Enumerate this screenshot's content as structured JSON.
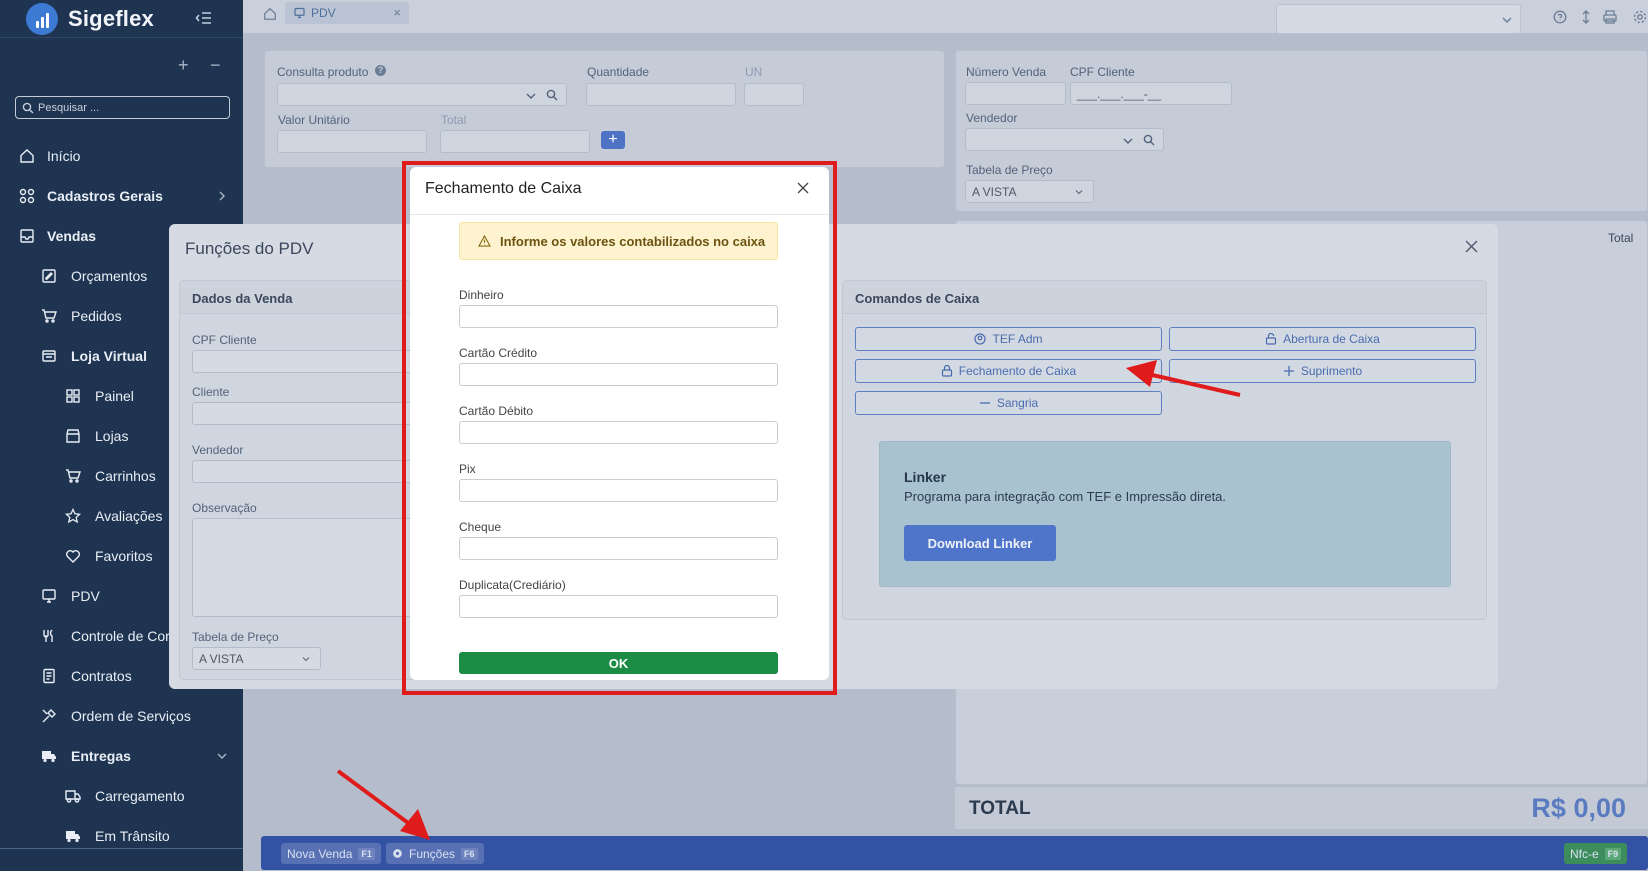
{
  "app": {
    "name": "Sigeflex"
  },
  "sidebar": {
    "search_placeholder": "Pesquisar ...",
    "items": [
      {
        "label": "Início",
        "icon": "home-icon"
      },
      {
        "label": "Cadastros Gerais",
        "icon": "grid-icon"
      },
      {
        "label": "Vendas",
        "icon": "inbox-icon"
      },
      {
        "label": "Orçamentos",
        "icon": "edit-icon"
      },
      {
        "label": "Pedidos",
        "icon": "cart-icon"
      },
      {
        "label": "Loja Virtual",
        "icon": "store-icon"
      },
      {
        "label": "Painel",
        "icon": "dashboard-icon"
      },
      {
        "label": "Lojas",
        "icon": "shop-icon"
      },
      {
        "label": "Carrinhos",
        "icon": "cart-icon"
      },
      {
        "label": "Avaliações",
        "icon": "star-icon"
      },
      {
        "label": "Favoritos",
        "icon": "heart-icon"
      },
      {
        "label": "PDV",
        "icon": "monitor-icon"
      },
      {
        "label": "Controle de Cor",
        "icon": "utensils-icon"
      },
      {
        "label": "Contratos",
        "icon": "document-icon"
      },
      {
        "label": "Ordem de Serviços",
        "icon": "tools-icon"
      },
      {
        "label": "Entregas",
        "icon": "truck-icon"
      },
      {
        "label": "Carregamento",
        "icon": "truck-icon"
      },
      {
        "label": "Em Trânsito",
        "icon": "truck-icon"
      }
    ]
  },
  "tabs": {
    "active": "PDV"
  },
  "form": {
    "consulta_produto": "Consulta produto",
    "quantidade": "Quantidade",
    "un": "UN",
    "valor_unitario": "Valor Unitário",
    "total": "Total",
    "numero_venda": "Número Venda",
    "cpf_cliente": "CPF Cliente",
    "cpf_placeholder": "___.___.___-__",
    "vendedor": "Vendedor",
    "tabela_preco": "Tabela de Preço",
    "tabela_preco_value": "A VISTA",
    "items_total_header": "Total"
  },
  "totals": {
    "label": "TOTAL",
    "value": "R$ 0,00"
  },
  "bottom_bar": {
    "nova_venda": "Nova Venda",
    "nova_venda_key": "F1",
    "funcoes": "Funções",
    "funcoes_key": "F6",
    "nfce": "Nfc-e",
    "nfce_key": "F9"
  },
  "funcoes_modal": {
    "title": "Funções do PDV",
    "dados_venda": {
      "title": "Dados da Venda",
      "cpf_cliente": "CPF Cliente",
      "cliente": "Cliente",
      "vendedor": "Vendedor",
      "observacao": "Observação",
      "tabela_preco": "Tabela de Preço",
      "tabela_preco_value": "A VISTA"
    },
    "comandos": {
      "title": "Comandos de Caixa",
      "tef_adm": "TEF Adm",
      "abertura": "Abertura de Caixa",
      "fechamento": "Fechamento de Caixa",
      "suprimento": "Suprimento",
      "sangria": "Sangria"
    },
    "linker": {
      "title": "Linker",
      "description": "Programa para integração com TEF e Impressão direta.",
      "button": "Download Linker"
    }
  },
  "fechamento_modal": {
    "title": "Fechamento de Caixa",
    "alert": "Informe os valores contabilizados no caixa",
    "fields": {
      "dinheiro": "Dinheiro",
      "cartao_credito": "Cartão Crédito",
      "cartao_debito": "Cartão Débito",
      "pix": "Pix",
      "cheque": "Cheque",
      "duplicata": "Duplicata(Crediário)"
    },
    "ok": "OK"
  },
  "colors": {
    "sidebar": "#1f3450",
    "accent": "#3452a3",
    "ok_green": "#1c8c45",
    "highlight_red": "#e01b1b",
    "alert_bg": "#fdf3cf"
  }
}
